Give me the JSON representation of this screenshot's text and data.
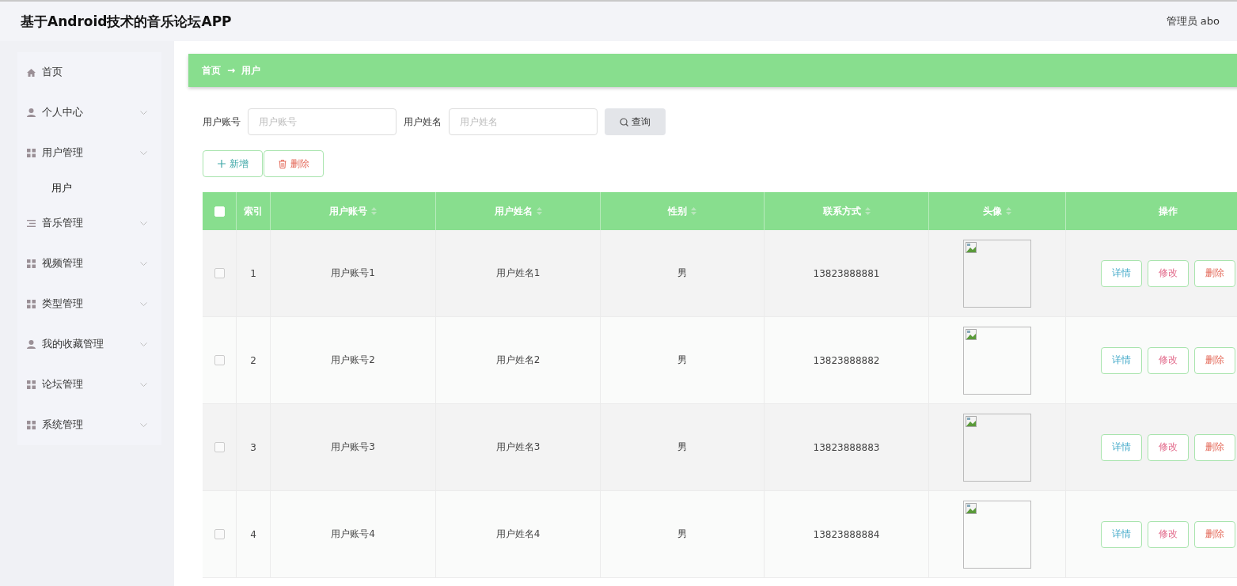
{
  "header": {
    "title": "基于Android技术的音乐论坛APP",
    "user": "管理员 abo"
  },
  "sidebar": {
    "items": [
      {
        "label": "首页",
        "kind": "home",
        "expandable": false,
        "selected": false
      },
      {
        "label": "个人中心",
        "kind": "user",
        "expandable": true,
        "selected": false
      },
      {
        "label": "用户管理",
        "kind": "grid",
        "expandable": true,
        "selected": false,
        "children": [
          {
            "label": "用户",
            "selected": true
          }
        ]
      },
      {
        "label": "音乐管理",
        "kind": "list",
        "expandable": true,
        "selected": false
      },
      {
        "label": "视频管理",
        "kind": "grid",
        "expandable": true,
        "selected": false
      },
      {
        "label": "类型管理",
        "kind": "grid",
        "expandable": true,
        "selected": false
      },
      {
        "label": "我的收藏管理",
        "kind": "user",
        "expandable": true,
        "selected": false
      },
      {
        "label": "论坛管理",
        "kind": "grid",
        "expandable": true,
        "selected": false
      },
      {
        "label": "系统管理",
        "kind": "grid",
        "expandable": true,
        "selected": false
      }
    ]
  },
  "breadcrumb": [
    "首页",
    "→",
    "用户"
  ],
  "search": {
    "fields": [
      {
        "label": "用户账号",
        "placeholder": "用户账号"
      },
      {
        "label": "用户姓名",
        "placeholder": "用户姓名"
      }
    ],
    "button": "查询"
  },
  "actions": [
    {
      "kind": "add",
      "label": "新增"
    },
    {
      "kind": "delete",
      "label": "删除"
    }
  ],
  "table": {
    "select_all_checked": false,
    "columns": [
      {
        "label": "索引",
        "sortable": false
      },
      {
        "label": "用户账号",
        "sortable": true
      },
      {
        "label": "用户姓名",
        "sortable": true
      },
      {
        "label": "性别",
        "sortable": true
      },
      {
        "label": "联系方式",
        "sortable": true
      },
      {
        "label": "头像",
        "sortable": true
      },
      {
        "label": "操作",
        "sortable": false
      }
    ],
    "rows": [
      {
        "checked": false,
        "cells": [
          "1",
          "用户账号1",
          "用户姓名1",
          "男",
          "13823888881"
        ],
        "buttons": [
          {
            "kind": "detail",
            "label": "详情"
          },
          {
            "kind": "edit",
            "label": "修改"
          },
          {
            "kind": "delete",
            "label": "删除"
          }
        ]
      },
      {
        "checked": false,
        "cells": [
          "2",
          "用户账号2",
          "用户姓名2",
          "男",
          "13823888882"
        ],
        "buttons": [
          {
            "kind": "detail",
            "label": "详情"
          },
          {
            "kind": "edit",
            "label": "修改"
          },
          {
            "kind": "delete",
            "label": "删除"
          }
        ]
      },
      {
        "checked": false,
        "cells": [
          "3",
          "用户账号3",
          "用户姓名3",
          "男",
          "13823888883"
        ],
        "buttons": [
          {
            "kind": "detail",
            "label": "详情"
          },
          {
            "kind": "edit",
            "label": "修改"
          },
          {
            "kind": "delete",
            "label": "删除"
          }
        ]
      },
      {
        "checked": false,
        "cells": [
          "4",
          "用户账号4",
          "用户姓名4",
          "男",
          "13823888884"
        ],
        "buttons": [
          {
            "kind": "detail",
            "label": "详情"
          },
          {
            "kind": "edit",
            "label": "修改"
          },
          {
            "kind": "delete",
            "label": "删除"
          }
        ]
      }
    ]
  }
}
